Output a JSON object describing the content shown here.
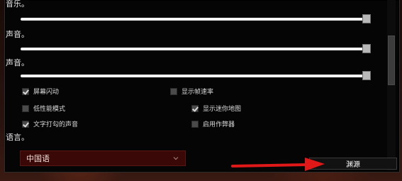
{
  "settings": {
    "music_label": "音乐。",
    "sound_label": "声音。",
    "voice_label": "声音。",
    "music_level": 1.0,
    "sound_level": 1.0,
    "voice_level": 1.0,
    "options": [
      {
        "label": "屏幕闪动",
        "checked": true
      },
      {
        "label": "显示帧速率",
        "checked": false
      },
      {
        "label": "低性能模式",
        "checked": false
      },
      {
        "label": "显示迷你地图",
        "checked": true
      },
      {
        "label": "文字打勾的声音",
        "checked": true
      },
      {
        "label": "启用作弊器",
        "checked": false
      }
    ],
    "language_label": "语言。",
    "language_value": "中国语",
    "source_button_label": "渊源"
  },
  "colors": {
    "panel_bg": "#050505",
    "select_bg": "#3a0807",
    "arrow": "#e01818"
  },
  "icons": {
    "check": "check-icon",
    "dropdown": "chevron-down-icon",
    "arrow": "arrow-right-icon"
  }
}
